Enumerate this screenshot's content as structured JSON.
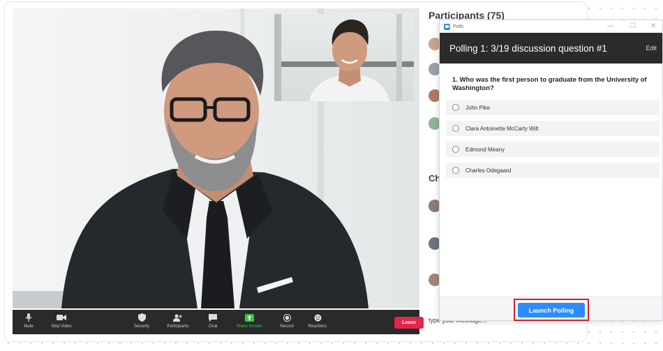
{
  "participants": {
    "title": "Participants (75)"
  },
  "chat": {
    "title": "Chat",
    "input_placeholder": "type your message..."
  },
  "video": {
    "main_speaker_alt": "Speaker video",
    "pip_alt": "Participant video"
  },
  "controls": {
    "mute": "Mute",
    "stop_video": "Stop Video",
    "security": "Security",
    "participants": "Participants",
    "chat": "Chat",
    "share_screen": "Share Screen",
    "record": "Record",
    "reactions": "Reactions",
    "leave": "Leave"
  },
  "poll_window": {
    "app_title": "Polls",
    "header_title": "Polling 1: 3/19 discussion question #1",
    "edit_label": "Edit",
    "question": "1. Who was the first person to graduate from the University of Washington?",
    "options": [
      "John Pike",
      "Clara Antoinette McCarty Wilt",
      "Edmond Meany",
      "Charles Odegaard"
    ],
    "launch_label": "Launch Polling"
  },
  "colors": {
    "accent": "#2d8cff",
    "leave": "#e0274a",
    "highlight": "#d0242e",
    "share_green": "#3cc153"
  }
}
